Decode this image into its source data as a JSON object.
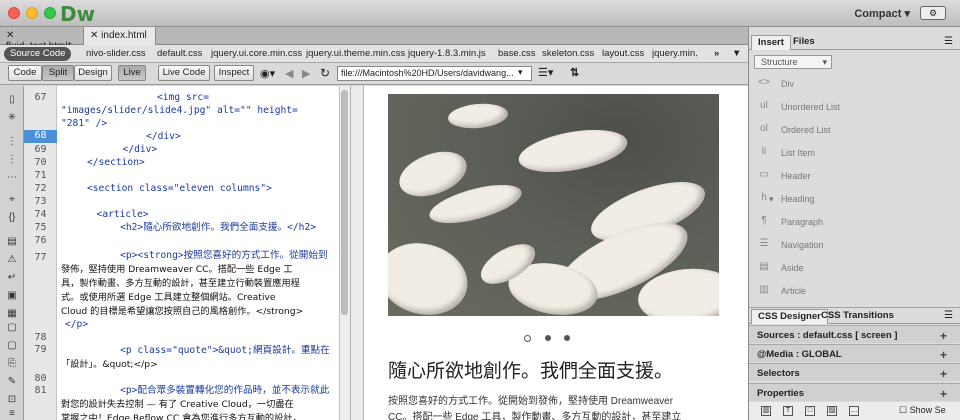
{
  "app": {
    "logo": "Dw",
    "workspace": "Compact",
    "workspace_icon": "gear-icon"
  },
  "doc_tabs": [
    {
      "label": "fluid_test.html*"
    },
    {
      "label": "index.html"
    }
  ],
  "related": {
    "source": "Source Code",
    "files": [
      "nivo-slider.css",
      "default.css",
      "jquery.ui.core.min.css",
      "jquery.ui.theme.min.css",
      "jquery-1.8.3.min.js",
      "base.css",
      "skeleton.css",
      "layout.css",
      "jquery.min.j"
    ]
  },
  "toolbar": {
    "code": "Code",
    "split": "Split",
    "design": "Design",
    "live": "Live",
    "live_code": "Live Code",
    "inspect": "Inspect",
    "address": "file:///Macintosh%20HD/Users/davidwang..."
  },
  "line_numbers": [
    "67",
    "68",
    "69",
    "70",
    "71",
    "72",
    "73",
    "74",
    "75",
    "76",
    "77",
    "78",
    "79",
    "80",
    "81"
  ],
  "current_line": "68",
  "code_lines": [
    "<img src=",
    "\"images/slider/slide4.jpg\" alt=\"\" height=",
    "\"281\" />",
    "    </div>",
    "  </div>",
    "</section>",
    "",
    "<section class=\"eleven columns\">",
    "",
    "  <article>",
    "    <h2>隨心所欲地創作。我們全面支援。</h2>",
    "",
    "    <p><strong>按照您喜好的方式工作。從開始到",
    "發佈，堅持使用 Dreamweaver CC。搭配一些 Edge 工",
    "具，製作動畫、多方互動的設計，甚至建立行動裝置應用程",
    "式。或使用所選 Edge 工具建立整個網站。Creative",
    "Cloud 的目標是希望讓您按照自己的風格創作。</strong>",
    "</p>",
    "",
    "    <p class=\"quote\">&quot;網頁設計。重點在",
    "「設計」。&quot;</p>",
    "",
    "    <p>配合眾多裝置轉化您的作品時，並不表示就此",
    "對您的設計失去控制 — 有了 Creative Cloud，一切盡在",
    "掌握之中！Edge Reflow CC 會為您進行多方互動的設計，"
  ],
  "live": {
    "heading": "隨心所欲地創作。我們全面支援。",
    "para": "按照您喜好的方式工作。從開始到發佈，堅持使用 Dreamweaver",
    "para2": "CC。搭配一些 Edge 工具，製作動畫、多方互動的設計，甚至建立"
  },
  "panel": {
    "tabs": [
      "Insert",
      "Files"
    ],
    "category": "Structure",
    "items": [
      {
        "icon": "<>",
        "label": "Div"
      },
      {
        "icon": "ul",
        "label": "Unordered List"
      },
      {
        "icon": "ol",
        "label": "Ordered List"
      },
      {
        "icon": "li",
        "label": "List Item"
      },
      {
        "icon": "▭",
        "label": "Header"
      },
      {
        "icon": "h",
        "label": "Heading"
      },
      {
        "icon": "¶",
        "label": "Paragraph"
      },
      {
        "icon": "☰",
        "label": "Navigation"
      },
      {
        "icon": "▤",
        "label": "Aside"
      },
      {
        "icon": "▥",
        "label": "Article"
      }
    ],
    "css_tabs": [
      "CSS Designer",
      "CSS Transitions"
    ],
    "sources": "Sources : default.css  [ screen ]",
    "media": "@Media : GLOBAL",
    "selectors": "Selectors",
    "properties": "Properties",
    "show_set": "Show Se"
  },
  "colors": {
    "accent": "#4a90d9",
    "logo": "#3d8b3d"
  }
}
